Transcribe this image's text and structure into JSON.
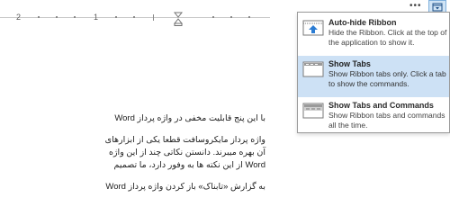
{
  "ruler": {
    "numbers": [
      "2",
      "1"
    ]
  },
  "window_controls": {
    "more_icon": "more-options-icon",
    "ribbon_display_icon": "ribbon-display-options-icon"
  },
  "document": {
    "paragraphs": [
      "با این پنج قابلیت مخفی در واژه پرداز Word",
      "واژه پرداز مایکروسافت قطعا یکی از ابزارهای",
      "آن بهره میبرند. دانستن نکاتی چند از این واژه",
      "Word از این نکته ها به وفور دارد، ما تصمیم",
      "به گزارش «تابناک» باز کردن واژه پرداز Word"
    ]
  },
  "menu": {
    "items": [
      {
        "title": "Auto-hide Ribbon",
        "description": "Hide the Ribbon. Click at the top of the application to show it.",
        "icon": "auto-hide-ribbon-icon",
        "selected": false
      },
      {
        "title": "Show Tabs",
        "description": "Show Ribbon tabs only. Click a tab to show the commands.",
        "icon": "show-tabs-icon",
        "selected": true
      },
      {
        "title": "Show Tabs and Commands",
        "description": "Show Ribbon tabs and commands all the time.",
        "icon": "show-tabs-commands-icon",
        "selected": false
      }
    ]
  },
  "colors": {
    "selected_bg": "#cde1f5",
    "accent": "#2b7cd3"
  }
}
